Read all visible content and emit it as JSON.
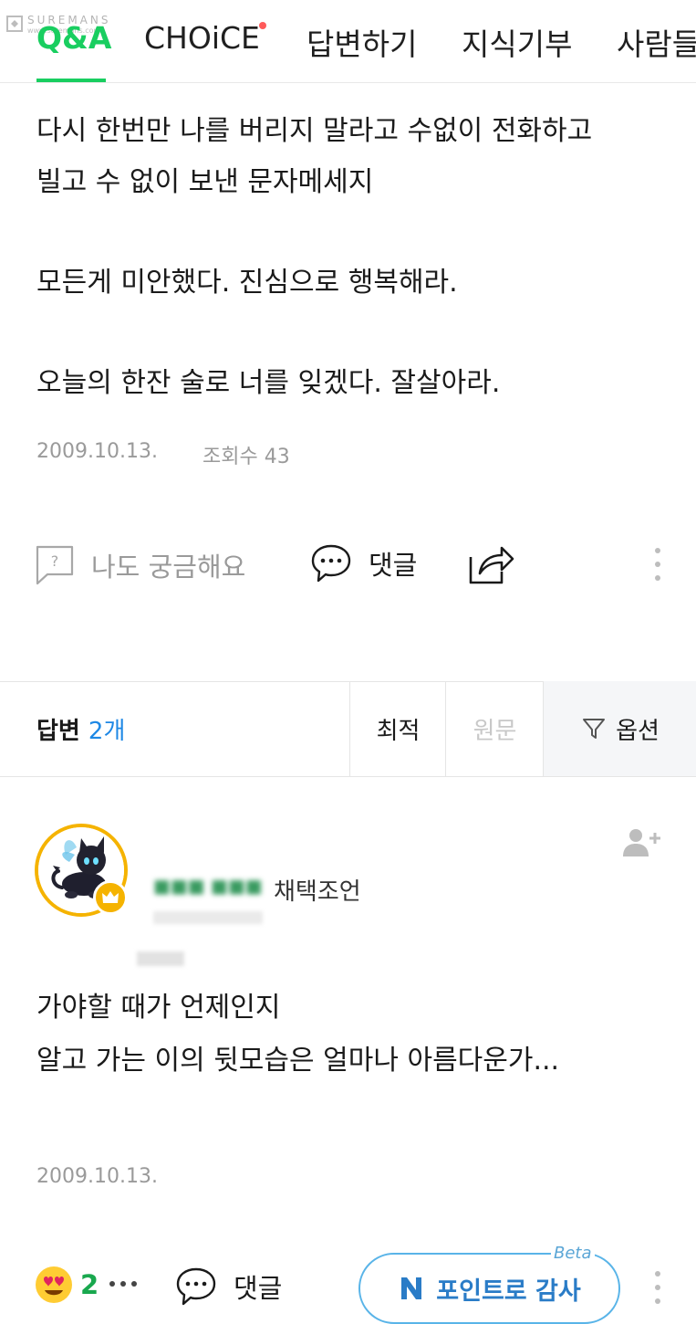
{
  "watermark": {
    "brand": "SUREMANS",
    "sub": "www.suremans.com"
  },
  "nav": {
    "tabs": [
      {
        "label": "Q&A",
        "active": true
      },
      {
        "label": "CHOiCE",
        "dot": true
      },
      {
        "label": "답변하기"
      },
      {
        "label": "지식기부"
      },
      {
        "label": "사람들"
      }
    ]
  },
  "question": {
    "lines": [
      "다시 한번만 나를 버리지 말라고 수없이 전화하고",
      "빌고 수 없이 보낸 문자메세지",
      "모든게 미안했다. 진심으로 행복해라.",
      "오늘의 한잔 술로 너를 잊겠다. 잘살아라."
    ],
    "date": "2009.10.13.",
    "views": "조회수 43",
    "actions": {
      "curious": "나도 궁금해요",
      "comment": "댓글"
    }
  },
  "answers_header": {
    "label": "답변",
    "count": "2개",
    "sort": {
      "best": "최적",
      "original": "원문",
      "option": "옵션"
    }
  },
  "answer": {
    "author_tag": "채택조언",
    "lines": [
      "가야할 때가 언제인지",
      "알고 가는 이의 뒷모습은 얼마나 아름다운가..."
    ],
    "date": "2009.10.13.",
    "reaction_count": "2",
    "comment_label": "댓글",
    "thanks_label": "포인트로 감사",
    "beta_label": "Beta"
  },
  "colors": {
    "accent_green": "#19ce60",
    "accent_blue": "#1e88e5",
    "gold": "#f5b300"
  }
}
